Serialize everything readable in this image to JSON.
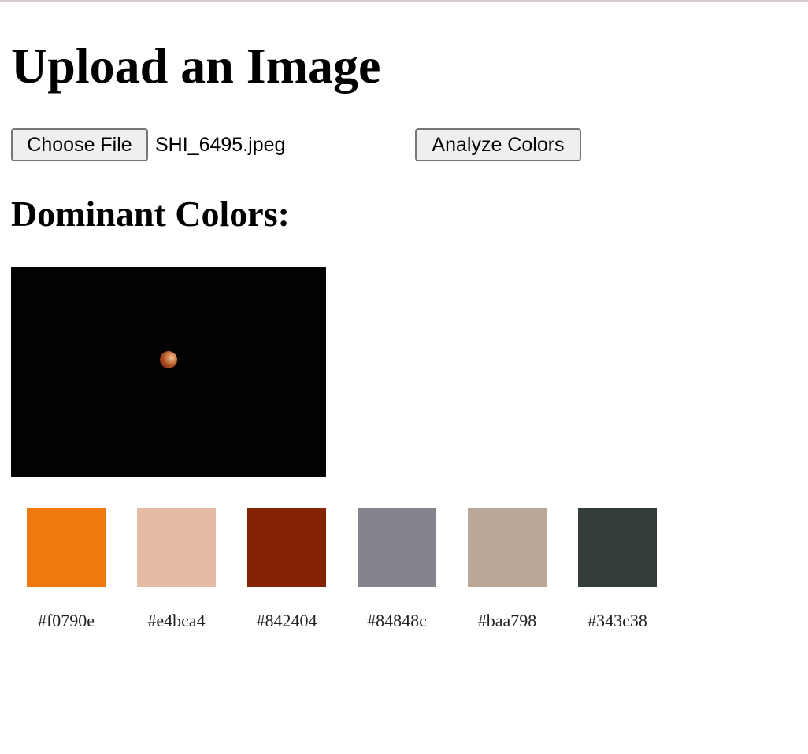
{
  "header": {
    "title": "Upload an Image"
  },
  "upload": {
    "choose_file_label": "Choose File",
    "file_name": "SHI_6495.jpeg",
    "analyze_label": "Analyze Colors"
  },
  "results": {
    "title": "Dominant Colors:",
    "swatches": [
      {
        "hex": "#f0790e",
        "label": "#f0790e"
      },
      {
        "hex": "#e4bca4",
        "label": "#e4bca4"
      },
      {
        "hex": "#842404",
        "label": "#842404"
      },
      {
        "hex": "#84848c",
        "label": "#84848c"
      },
      {
        "hex": "#baa798",
        "label": "#baa798"
      },
      {
        "hex": "#343c38",
        "label": "#343c38"
      }
    ]
  }
}
